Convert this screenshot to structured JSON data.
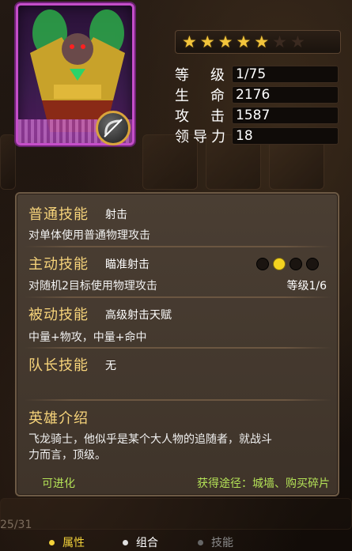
{
  "hero": {
    "stars_filled": 5,
    "stars_total": 7
  },
  "stats": {
    "level_label": "等　级",
    "level": "1/75",
    "hp_label": "生　命",
    "hp": "2176",
    "atk_label": "攻　击",
    "atk": "1587",
    "lead_label": "领导力",
    "lead": "18"
  },
  "skills": {
    "normal": {
      "title": "普通技能",
      "name": "射击",
      "desc": "对单体使用普通物理攻击"
    },
    "active": {
      "title": "主动技能",
      "name": "瞄准射击",
      "desc": "对随机2目标使用物理攻击",
      "level": "等级1/6"
    },
    "passive": {
      "title": "被动技能",
      "name": "高级射击天赋",
      "desc": "中量+物攻，中量+命中"
    },
    "leader": {
      "title": "队长技能",
      "name": "无"
    }
  },
  "intro": {
    "title": "英雄介绍",
    "line1": "飞龙骑士，他似乎是某个大人物的追随者，就战斗",
    "line2": "力而言，顶级。"
  },
  "footer": {
    "evolve": "可进化",
    "obtain": "获得途径：城墙、购买碎片",
    "page_count": "25/31"
  },
  "tabs": [
    {
      "label": "属性",
      "color": "#f3d23a"
    },
    {
      "label": "组合",
      "color": "#ffffff"
    },
    {
      "label": "技能",
      "color": "#888888"
    }
  ]
}
